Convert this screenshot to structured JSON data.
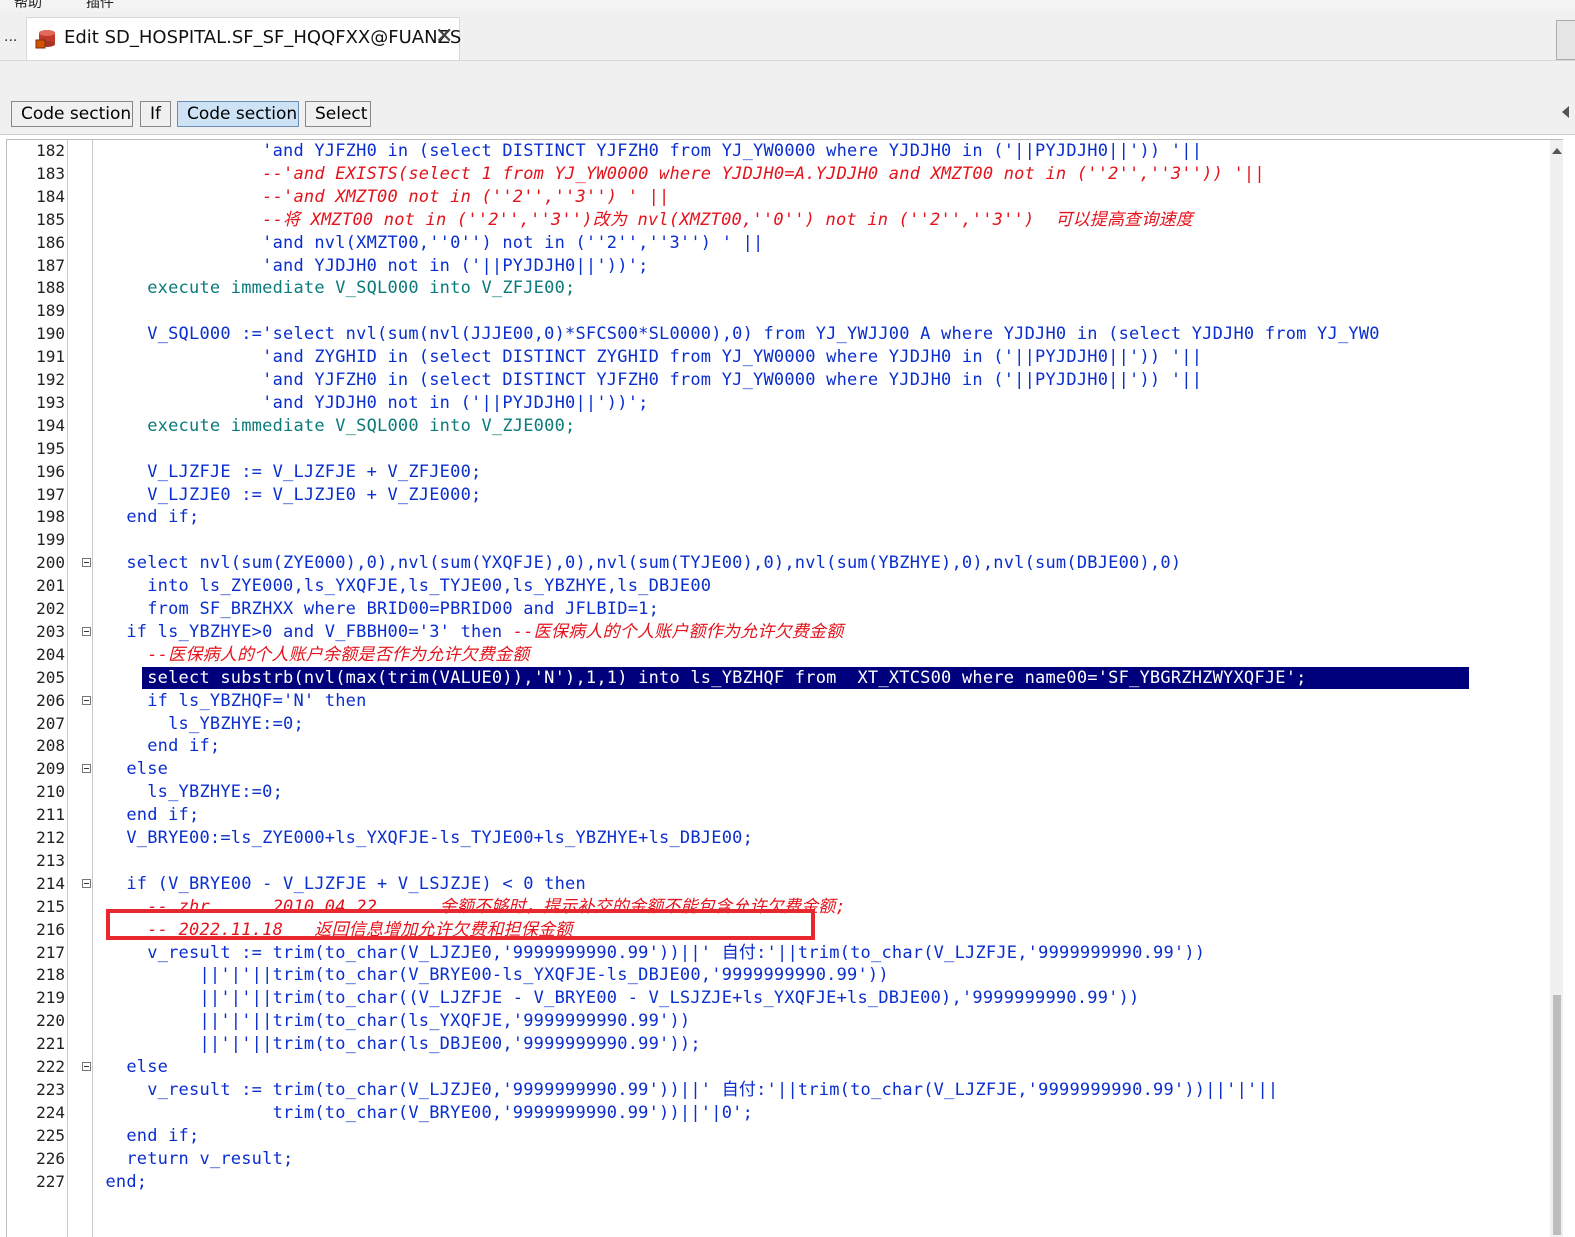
{
  "window": {
    "top_menu": [
      "帮助",
      "插件"
    ],
    "tab_overflow": "...",
    "tab": {
      "title": "Edit SD_HOSPITAL.SF_SF_HQQFXX@FUANZS",
      "close_glyph": "✕",
      "icon": "database-icon"
    }
  },
  "toolbar": {
    "buttons": [
      "Code section",
      "If",
      "Code section",
      "Select"
    ],
    "active_index": 2
  },
  "editor": {
    "selected_line": 205,
    "highlighted_line": 216,
    "lines": [
      {
        "n": "182",
        "fold": false,
        "style": "str",
        "text": "                'and YJFZH0 in (select DISTINCT YJFZH0 from YJ_YW0000 where YJDJH0 in ('||PYJDJH0||')) '||"
      },
      {
        "n": "183",
        "fold": false,
        "style": "cmt",
        "text": "                --'and EXISTS(select 1 from YJ_YW0000 where YJDJH0=A.YJDJH0 and XMZT00 not in (''2'',''3'')) '||"
      },
      {
        "n": "184",
        "fold": false,
        "style": "cmt",
        "text": "                --'and XMZT00 not in (''2'',''3'') ' ||"
      },
      {
        "n": "185",
        "fold": false,
        "style": "cmt",
        "text": "                --将 XMZT00 not in (''2'',''3'')改为 nvl(XMZT00,''0'') not in (''2'',''3'')  可以提高查询速度"
      },
      {
        "n": "186",
        "fold": false,
        "style": "str",
        "text": "                'and nvl(XMZT00,''0'') not in (''2'',''3'') ' ||"
      },
      {
        "n": "187",
        "fold": false,
        "style": "str",
        "text": "                'and YJDJH0 not in ('||PYJDJH0||'))';"
      },
      {
        "n": "188",
        "fold": false,
        "style": "kw",
        "text": "     execute immediate V_SQL000 into V_ZFJE00;"
      },
      {
        "n": "189",
        "fold": false,
        "style": "code",
        "text": ""
      },
      {
        "n": "190",
        "fold": false,
        "style": "code",
        "text": "     V_SQL000 :='select nvl(sum(nvl(JJJE00,0)*SFCS00*SL0000),0) from YJ_YWJJ00 A where YJDJH0 in (select YJDJH0 from YJ_YW0"
      },
      {
        "n": "191",
        "fold": false,
        "style": "str",
        "text": "                'and ZYGHID in (select DISTINCT ZYGHID from YJ_YW0000 where YJDJH0 in ('||PYJDJH0||')) '||"
      },
      {
        "n": "192",
        "fold": false,
        "style": "str",
        "text": "                'and YJFZH0 in (select DISTINCT YJFZH0 from YJ_YW0000 where YJDJH0 in ('||PYJDJH0||')) '||"
      },
      {
        "n": "193",
        "fold": false,
        "style": "str",
        "text": "                'and YJDJH0 not in ('||PYJDJH0||'))';"
      },
      {
        "n": "194",
        "fold": false,
        "style": "kw",
        "text": "     execute immediate V_SQL000 into V_ZJE000;"
      },
      {
        "n": "195",
        "fold": false,
        "style": "code",
        "text": ""
      },
      {
        "n": "196",
        "fold": false,
        "style": "code",
        "text": "     V_LJZFJE := V_LJZFJE + V_ZFJE00;"
      },
      {
        "n": "197",
        "fold": false,
        "style": "code",
        "text": "     V_LJZJE0 := V_LJZJE0 + V_ZJE000;"
      },
      {
        "n": "198",
        "fold": false,
        "style": "code",
        "text": "   end if;"
      },
      {
        "n": "199",
        "fold": false,
        "style": "code",
        "text": ""
      },
      {
        "n": "200",
        "fold": true,
        "style": "code",
        "text": "   select nvl(sum(ZYE000),0),nvl(sum(YXQFJE),0),nvl(sum(TYJE00),0),nvl(sum(YBZHYE),0),nvl(sum(DBJE00),0)"
      },
      {
        "n": "201",
        "fold": false,
        "style": "code",
        "text": "     into ls_ZYE000,ls_YXQFJE,ls_TYJE00,ls_YBZHYE,ls_DBJE00"
      },
      {
        "n": "202",
        "fold": false,
        "style": "code",
        "text": "     from SF_BRZHXX where BRID00=PBRID00 and JFLBID=1;"
      },
      {
        "n": "203",
        "fold": true,
        "style": "mixed",
        "text": "   if ls_YBZHYE>0 and V_FBBH00='3' then ",
        "tail": "--医保病人的个人账户额作为允许欠费金额"
      },
      {
        "n": "204",
        "fold": false,
        "style": "cmt",
        "text": "     --医保病人的个人账户余额是否作为允许欠费金额"
      },
      {
        "n": "205",
        "fold": false,
        "style": "sel",
        "text": "     select substrb(nvl(max(trim(VALUE0)),'N'),1,1) into ls_YBZHQF from  XT_XTCS00 where name00='SF_YBGRZHZWYXQFJE';"
      },
      {
        "n": "206",
        "fold": true,
        "style": "code",
        "text": "     if ls_YBZHQF='N' then"
      },
      {
        "n": "207",
        "fold": false,
        "style": "code",
        "text": "       ls_YBZHYE:=0;"
      },
      {
        "n": "208",
        "fold": false,
        "style": "code",
        "text": "     end if;"
      },
      {
        "n": "209",
        "fold": true,
        "style": "code",
        "text": "   else"
      },
      {
        "n": "210",
        "fold": false,
        "style": "code",
        "text": "     ls_YBZHYE:=0;"
      },
      {
        "n": "211",
        "fold": false,
        "style": "code",
        "text": "   end if;"
      },
      {
        "n": "212",
        "fold": false,
        "style": "code",
        "text": "   V_BRYE00:=ls_ZYE000+ls_YXQFJE-ls_TYJE00+ls_YBZHYE+ls_DBJE00;"
      },
      {
        "n": "213",
        "fold": false,
        "style": "code",
        "text": ""
      },
      {
        "n": "214",
        "fold": true,
        "style": "code",
        "text": "   if (V_BRYE00 - V_LJZFJE + V_LSJZJE) < 0 then"
      },
      {
        "n": "215",
        "fold": false,
        "style": "cmt",
        "text": "     -- zhr      2010.04.22      余额不够时，提示补交的金额不能包含允许欠费金额;"
      },
      {
        "n": "216",
        "fold": false,
        "style": "cmt",
        "text": "     -- 2022.11.18   返回信息增加允许欠费和担保金额"
      },
      {
        "n": "217",
        "fold": false,
        "style": "code",
        "text": "     v_result := trim(to_char(V_LJZJE0,'9999999990.99'))||' 自付:'||trim(to_char(V_LJZFJE,'9999999990.99'))"
      },
      {
        "n": "218",
        "fold": false,
        "style": "code",
        "text": "          ||'|'||trim(to_char(V_BRYE00-ls_YXQFJE-ls_DBJE00,'9999999990.99'))"
      },
      {
        "n": "219",
        "fold": false,
        "style": "code",
        "text": "          ||'|'||trim(to_char((V_LJZFJE - V_BRYE00 - V_LSJZJE+ls_YXQFJE+ls_DBJE00),'9999999990.99'))"
      },
      {
        "n": "220",
        "fold": false,
        "style": "code",
        "text": "          ||'|'||trim(to_char(ls_YXQFJE,'9999999990.99'))"
      },
      {
        "n": "221",
        "fold": false,
        "style": "code",
        "text": "          ||'|'||trim(to_char(ls_DBJE00,'9999999990.99'));"
      },
      {
        "n": "222",
        "fold": true,
        "style": "code",
        "text": "   else"
      },
      {
        "n": "223",
        "fold": false,
        "style": "code",
        "text": "     v_result := trim(to_char(V_LJZJE0,'9999999990.99'))||' 自付:'||trim(to_char(V_LJZFJE,'9999999990.99'))||'|'||"
      },
      {
        "n": "224",
        "fold": false,
        "style": "code",
        "text": "                 trim(to_char(V_BRYE00,'9999999990.99'))||'|0';"
      },
      {
        "n": "225",
        "fold": false,
        "style": "code",
        "text": "   end if;"
      },
      {
        "n": "226",
        "fold": false,
        "style": "code",
        "text": "   return v_result;"
      },
      {
        "n": "227",
        "fold": false,
        "style": "code",
        "text": " end;"
      }
    ]
  },
  "colors": {
    "code": "#0a2ecf",
    "comment": "#e4131b",
    "keyword_teal": "#0a7a7a",
    "selection": "#00007d",
    "highlight_box": "#e8282f"
  }
}
